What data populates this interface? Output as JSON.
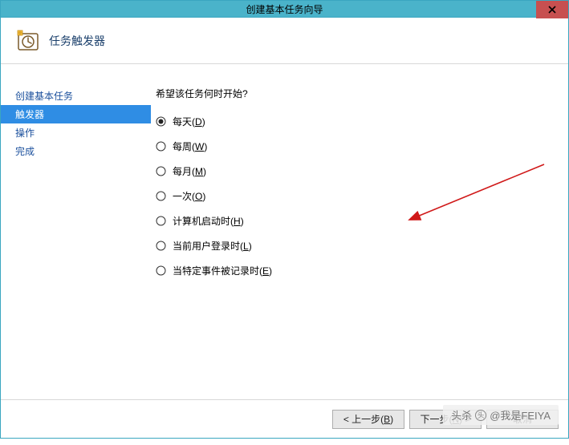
{
  "window": {
    "title": "创建基本任务向导"
  },
  "header": {
    "title": "任务触发器"
  },
  "sidebar": {
    "items": [
      {
        "label": "创建基本任务",
        "active": false
      },
      {
        "label": "触发器",
        "active": true
      },
      {
        "label": "操作",
        "active": false
      },
      {
        "label": "完成",
        "active": false
      }
    ]
  },
  "main": {
    "prompt": "希望该任务何时开始?",
    "options": [
      {
        "text": "每天",
        "mnemonic": "D",
        "selected": true
      },
      {
        "text": "每周",
        "mnemonic": "W",
        "selected": false
      },
      {
        "text": "每月",
        "mnemonic": "M",
        "selected": false
      },
      {
        "text": "一次",
        "mnemonic": "O",
        "selected": false
      },
      {
        "text": "计算机启动时",
        "mnemonic": "H",
        "selected": false
      },
      {
        "text": "当前用户登录时",
        "mnemonic": "L",
        "selected": false
      },
      {
        "text": "当特定事件被记录时",
        "mnemonic": "E",
        "selected": false
      }
    ]
  },
  "footer": {
    "back": {
      "prefix": "< 上一步(",
      "mnemonic": "B",
      "suffix": ")"
    },
    "next": {
      "prefix": "下一步(",
      "mnemonic": "N",
      "suffix": ") >"
    },
    "cancel": {
      "label": "取消"
    }
  },
  "watermark": {
    "prefix": "头杀",
    "text": "@我是FEIYA"
  }
}
